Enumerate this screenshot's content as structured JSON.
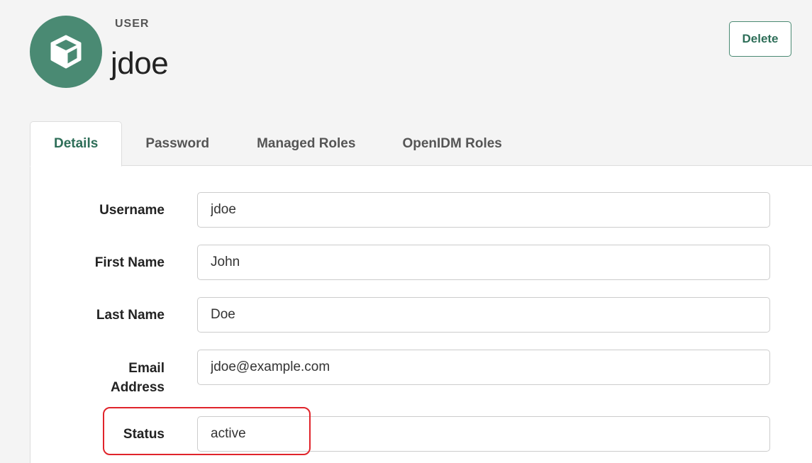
{
  "header": {
    "entity_type": "USER",
    "entity_name": "jdoe",
    "avatar_icon": "cube-icon",
    "delete_label": "Delete",
    "accent_color": "#4a8a73"
  },
  "tabs": [
    {
      "label": "Details",
      "active": true
    },
    {
      "label": "Password",
      "active": false
    },
    {
      "label": "Managed Roles",
      "active": false
    },
    {
      "label": "OpenIDM Roles",
      "active": false
    }
  ],
  "form": {
    "username": {
      "label": "Username",
      "value": "jdoe"
    },
    "first_name": {
      "label": "First Name",
      "value": "John"
    },
    "last_name": {
      "label": "Last Name",
      "value": "Doe"
    },
    "email": {
      "label_line1": "Email",
      "label_line2": "Address",
      "value": "jdoe@example.com"
    },
    "status": {
      "label": "Status",
      "value": "active"
    }
  },
  "annotation": {
    "highlight_color": "#e0242b"
  }
}
